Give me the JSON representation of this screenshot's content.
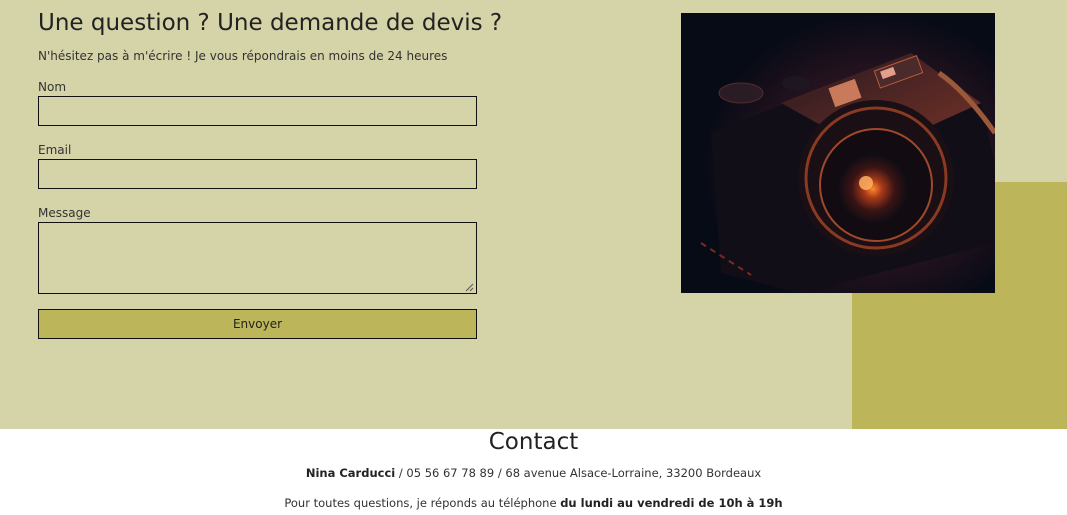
{
  "quote": {
    "title": "Une question ? Une demande de devis ?",
    "subtitle": "N'hésitez pas à m'écrire ! Je vous répondrais en moins de 24 heures",
    "fields": {
      "name_label": "Nom",
      "name_value": "",
      "email_label": "Email",
      "email_value": "",
      "message_label": "Message",
      "message_value": ""
    },
    "submit_label": "Envoyer",
    "image_subject": "vintage-camera-photo"
  },
  "contact": {
    "title": "Contact",
    "name": "Nina Carducci",
    "details": " / 05 56 67 78 89 / 68 avenue Alsace-Lorraine, 33200 Bordeaux",
    "hours_prefix": "Pour toutes questions, je réponds au téléphone ",
    "hours_bold": "du lundi au vendredi de 10h à 19h"
  },
  "colors": {
    "section_bg": "#d5d3a8",
    "accent": "#bdb55a",
    "border": "#111111"
  }
}
